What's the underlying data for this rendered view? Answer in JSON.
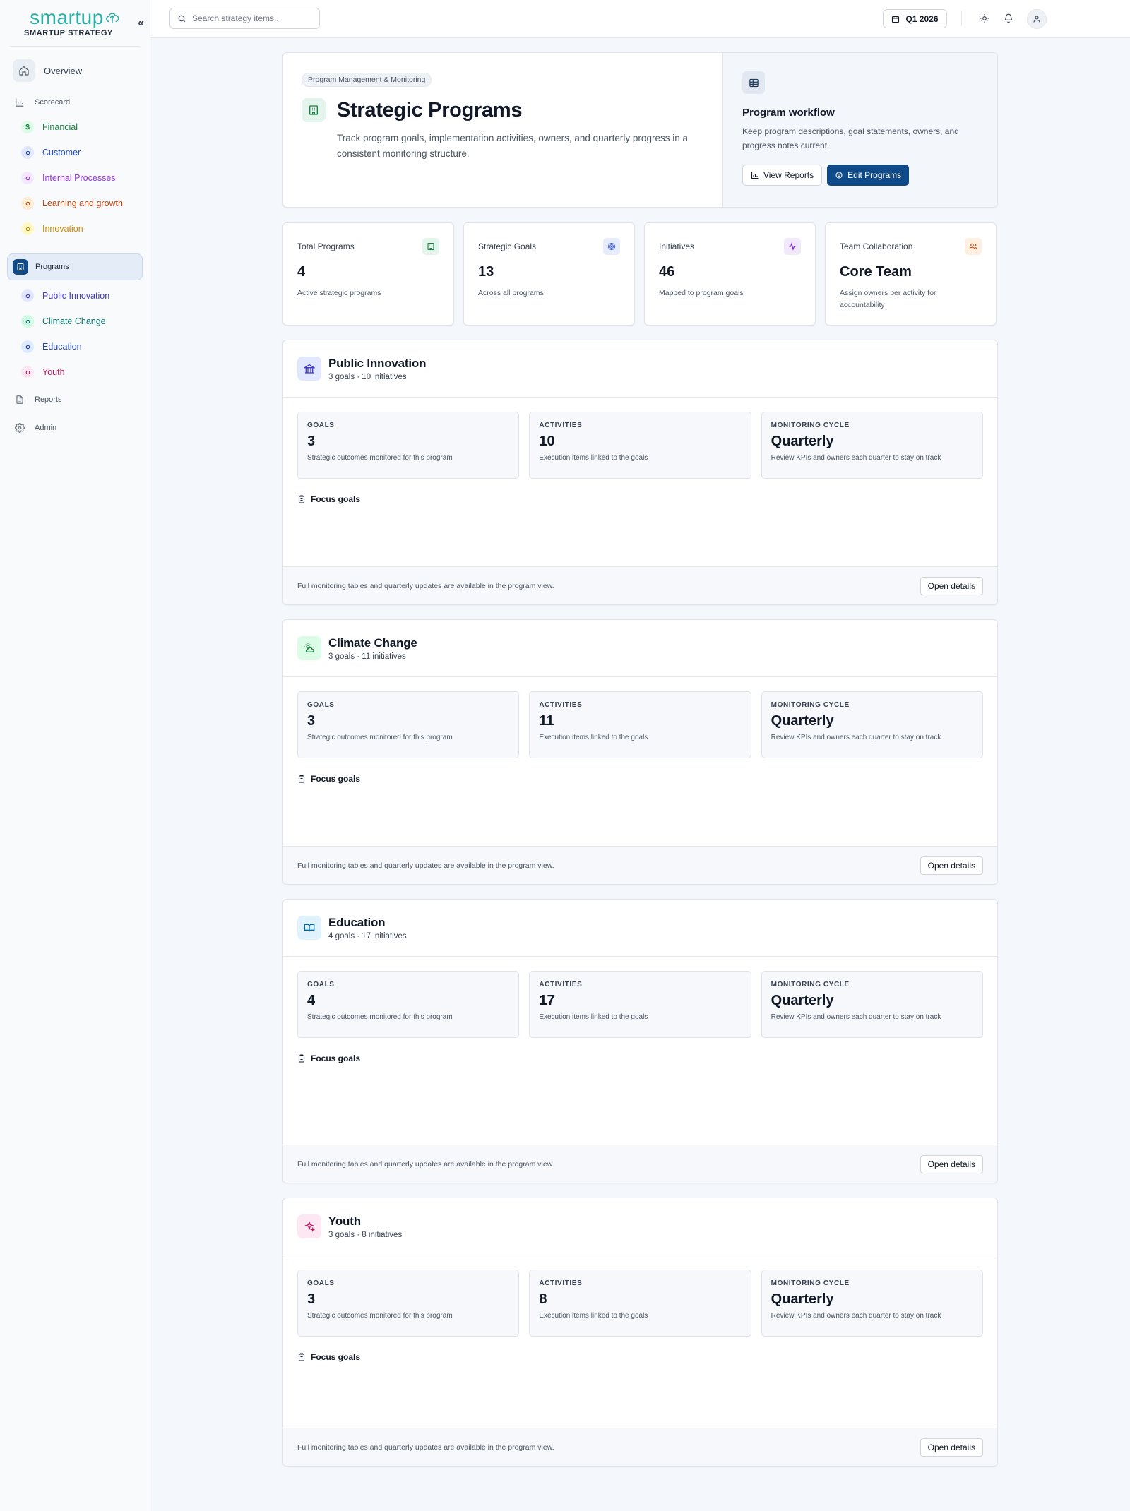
{
  "brand": {
    "logo": "smartup",
    "name": "SMARTUP STRATEGY",
    "collapse_glyph": "«"
  },
  "sidebar": {
    "overview": "Overview",
    "scorecard": "Scorecard",
    "scorecard_items": [
      {
        "label": "Financial",
        "color": "#15803d",
        "bg": "#dcfce7",
        "glyph": "$"
      },
      {
        "label": "Customer",
        "color": "#1d4ed8",
        "bg": "#e0e7ff"
      },
      {
        "label": "Internal Processes",
        "color": "#9333ea",
        "bg": "#f3e8ff"
      },
      {
        "label": "Learning and growth",
        "color": "#c2410c",
        "bg": "#ffedd5"
      },
      {
        "label": "Innovation",
        "color": "#ca8a04",
        "bg": "#fef9c3"
      }
    ],
    "programs": "Programs",
    "program_items": [
      {
        "label": "Public Innovation",
        "color": "#4338ca",
        "bg": "#e0e7ff"
      },
      {
        "label": "Climate Change",
        "color": "#0f766e",
        "bg": "#d1fae5"
      },
      {
        "label": "Education",
        "color": "#1e40af",
        "bg": "#dbeafe"
      },
      {
        "label": "Youth",
        "color": "#be185d",
        "bg": "#fce7f3"
      }
    ],
    "reports": "Reports",
    "admin": "Admin"
  },
  "topbar": {
    "search_placeholder": "Search strategy items...",
    "quarter": "Q1 2026"
  },
  "hero": {
    "badge": "Program Management & Monitoring",
    "title": "Strategic Programs",
    "description": "Track program goals, implementation activities, owners, and quarterly progress in a consistent monitoring structure.",
    "workflow_title": "Program workflow",
    "workflow_desc": "Keep program descriptions, goal statements, owners, and progress notes current.",
    "view_reports": "View Reports",
    "edit_programs": "Edit Programs"
  },
  "stats": [
    {
      "label": "Total Programs",
      "value": "4",
      "sub": "Active strategic programs"
    },
    {
      "label": "Strategic Goals",
      "value": "13",
      "sub": "Across all programs"
    },
    {
      "label": "Initiatives",
      "value": "46",
      "sub": "Mapped to program goals"
    },
    {
      "label": "Team Collaboration",
      "value": "Core Team",
      "sub": "Assign owners per activity for accountability"
    }
  ],
  "common": {
    "goals_label": "GOALS",
    "goals_sub": "Strategic outcomes monitored for this program",
    "activities_label": "ACTIVITIES",
    "activities_sub": "Execution items linked to the goals",
    "cycle_label": "MONITORING CYCLE",
    "cycle_value": "Quarterly",
    "cycle_sub": "Review KPIs and owners each quarter to stay on track",
    "focus_goals": "Focus goals",
    "footer_text": "Full monitoring tables and quarterly updates are available in the program view.",
    "open_details": "Open details"
  },
  "programs": [
    {
      "name": "Public Innovation",
      "meta": "3 goals · 10 initiatives",
      "goals": "3",
      "activities": "10",
      "icon_color": "#4338ca",
      "icon_bg": "#e0e7ff"
    },
    {
      "name": "Climate Change",
      "meta": "3 goals · 11 initiatives",
      "goals": "3",
      "activities": "11",
      "icon_color": "#15803d",
      "icon_bg": "#dcfce7"
    },
    {
      "name": "Education",
      "meta": "4 goals · 17 initiatives",
      "goals": "4",
      "activities": "17",
      "icon_color": "#0369a1",
      "icon_bg": "#e0f2fe"
    },
    {
      "name": "Youth",
      "meta": "3 goals · 8 initiatives",
      "goals": "3",
      "activities": "8",
      "icon_color": "#be185d",
      "icon_bg": "#fce7f3"
    }
  ]
}
